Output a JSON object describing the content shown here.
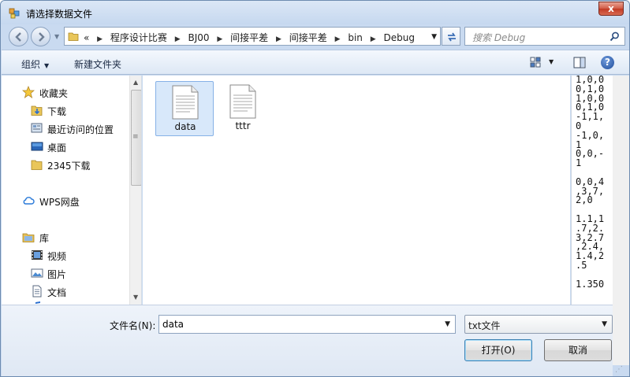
{
  "window": {
    "title": "请选择数据文件",
    "close_glyph": "x"
  },
  "address_bar": {
    "prefix": "«",
    "crumbs": [
      "程序设计比赛",
      "BJ00",
      "间接平差",
      "间接平差",
      "bin",
      "Debug"
    ]
  },
  "search": {
    "placeholder": "搜索 Debug"
  },
  "toolbar": {
    "organize_label": "组织",
    "new_folder_label": "新建文件夹",
    "help_glyph": "?"
  },
  "navigation": {
    "favorites": {
      "label": "收藏夹",
      "items": [
        "下载",
        "最近访问的位置",
        "桌面",
        "2345下载"
      ]
    },
    "cloud": {
      "label": "WPS网盘"
    },
    "libraries": {
      "label": "库",
      "items": [
        "视频",
        "图片",
        "文档"
      ]
    }
  },
  "files": [
    {
      "name": "data",
      "selected": true
    },
    {
      "name": "tttr",
      "selected": false
    }
  ],
  "preview_text": "1,0,0\n0,1,0\n1,0,0\n0,1,0\n-1,1,\n0\n-1,0,\n1\n0,0,-\n1\n\n0,0,4\n,3,7,\n2,0\n\n1.1,1\n.7,2.\n3,2.7\n,2.4,\n1.4,2\n.5\n\n1.350",
  "bottom": {
    "filename_label": "文件名(N):",
    "filename_value": "data",
    "filetype_value": "txt文件",
    "open_label": "打开(O)",
    "cancel_label": "取消"
  }
}
